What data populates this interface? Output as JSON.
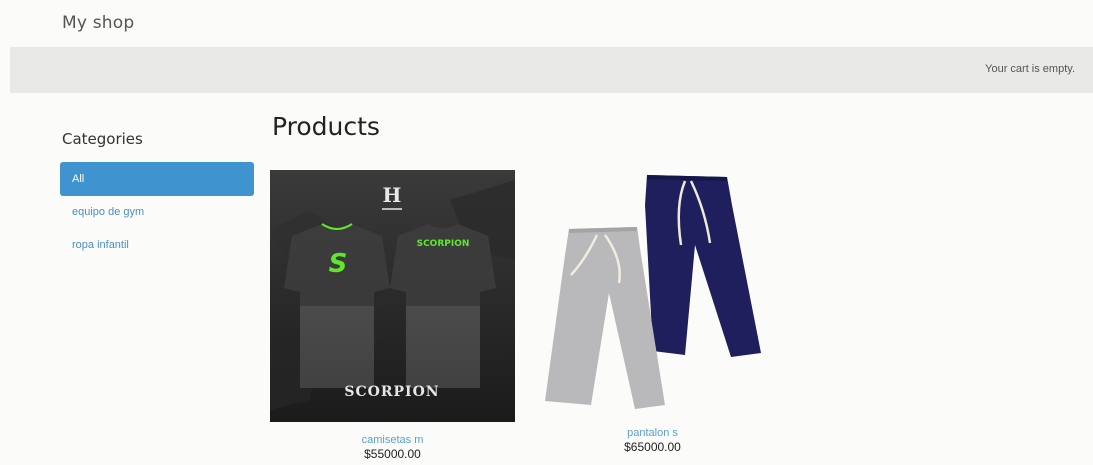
{
  "header": {
    "brand": "My shop"
  },
  "cart": {
    "status": "Your cart is empty."
  },
  "sidebar": {
    "title": "Categories",
    "items": [
      {
        "label": "All",
        "active": true
      },
      {
        "label": "equipo de gym",
        "active": false
      },
      {
        "label": "ropa infantil",
        "active": false
      }
    ]
  },
  "main": {
    "title": "Products",
    "products": [
      {
        "name": "camisetas m",
        "price": "$55000.00",
        "image_text": {
          "logo": "H",
          "brand": "SCORPION",
          "chest": "SCORPION",
          "mark": "S"
        }
      },
      {
        "name": "pantalon s",
        "price": "$65000.00"
      }
    ]
  },
  "colors": {
    "accent": "#3f93cf",
    "link": "#4a90c6",
    "cart_bar": "#e9e9e7",
    "scorpion_green": "#5ee82c",
    "pants_navy": "#1e1f5c",
    "pants_gray": "#b9b9bb"
  }
}
